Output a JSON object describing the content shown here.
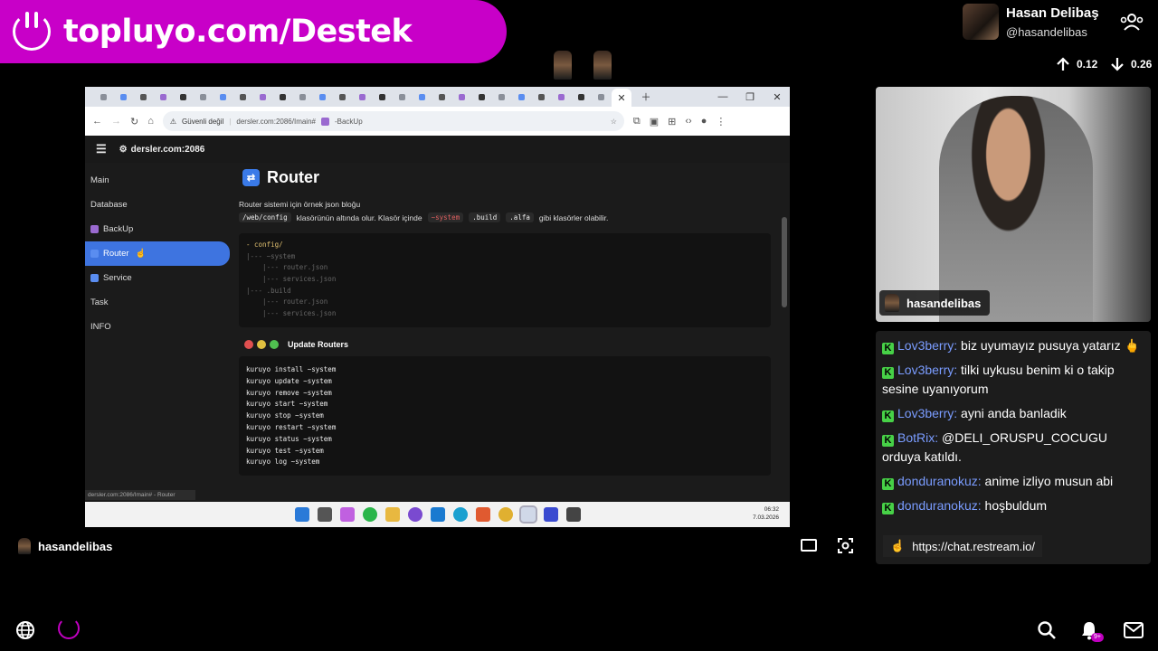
{
  "banner": {
    "text": "topluyo.com/Destek"
  },
  "profile": {
    "name": "Hasan Delibaş",
    "handle": "@hasandelibas",
    "up_value": "0.12",
    "down_value": "0.26"
  },
  "browser": {
    "address_warning": "Güvenli değil",
    "address_url": "dersler.com:2086/Imain#",
    "address_suffix": "-BackUp",
    "site_name": "dersler.com:2086",
    "sidebar": [
      {
        "label": "Main",
        "icon": ""
      },
      {
        "label": "Database",
        "icon": ""
      },
      {
        "label": "BackUp",
        "icon": "backup-icon"
      },
      {
        "label": "Router",
        "icon": "router-icon",
        "active": true
      },
      {
        "label": "Service",
        "icon": "service-icon"
      },
      {
        "label": "Task",
        "icon": ""
      },
      {
        "label": "INFO",
        "icon": ""
      }
    ],
    "title": "Router",
    "desc1": "Router sistemi için örnek json bloğu",
    "desc2": {
      "chip1": "/web/config",
      "text1": "klasörünün altında olur. Klasör içinde",
      "chip2": "~system",
      "chip3": ".build",
      "chip4": ".alfa",
      "text2": "gibi klasörler olabilir."
    },
    "tree": [
      "- config/",
      "|--- ~system",
      "    |--- router.json",
      "    |--- services.json",
      "|--- .build",
      "    |--- router.json",
      "    |--- services.json"
    ],
    "update_title": "Update Routers",
    "commands": [
      "kuruyo install ~system",
      "kuruyo update ~system",
      "kuruyo remove ~system",
      "kuruyo start ~system",
      "kuruyo stop ~system",
      "kuruyo restart ~system",
      "kuruyo status ~system",
      "kuruyo test ~system",
      "kuruyo log ~system"
    ],
    "status_url": "dersler.com:2086/Imain#",
    "status_suffix": "- Router",
    "clock_time": "06:32",
    "clock_date": "7.03.2026"
  },
  "cam_label": "hasandelibas",
  "chat": [
    {
      "user": "Lov3berry",
      "text": "biz uyumayız pusuya yatarız 🖕"
    },
    {
      "user": "Lov3berry",
      "text": "tilki uykusu benim ki o takip sesine uyanıyorum"
    },
    {
      "user": "Lov3berry",
      "text": "ayni anda banladik"
    },
    {
      "user": "BotRix",
      "text": "@DELI_ORUSPU_COCUGU orduya katıldı."
    },
    {
      "user": "donduranokuz",
      "text": "anime izliyo musun abi"
    },
    {
      "user": "donduranokuz",
      "text": "hoşbuldum"
    }
  ],
  "tooltip": "https://chat.restream.io/",
  "stream_user": "hasandelibas",
  "bell_badge": "9+",
  "colors": {
    "banner": "#c800c8",
    "accent_blue": "#3e74e0",
    "chat_user": "#7a9cff",
    "kick_green": "#47d147"
  }
}
